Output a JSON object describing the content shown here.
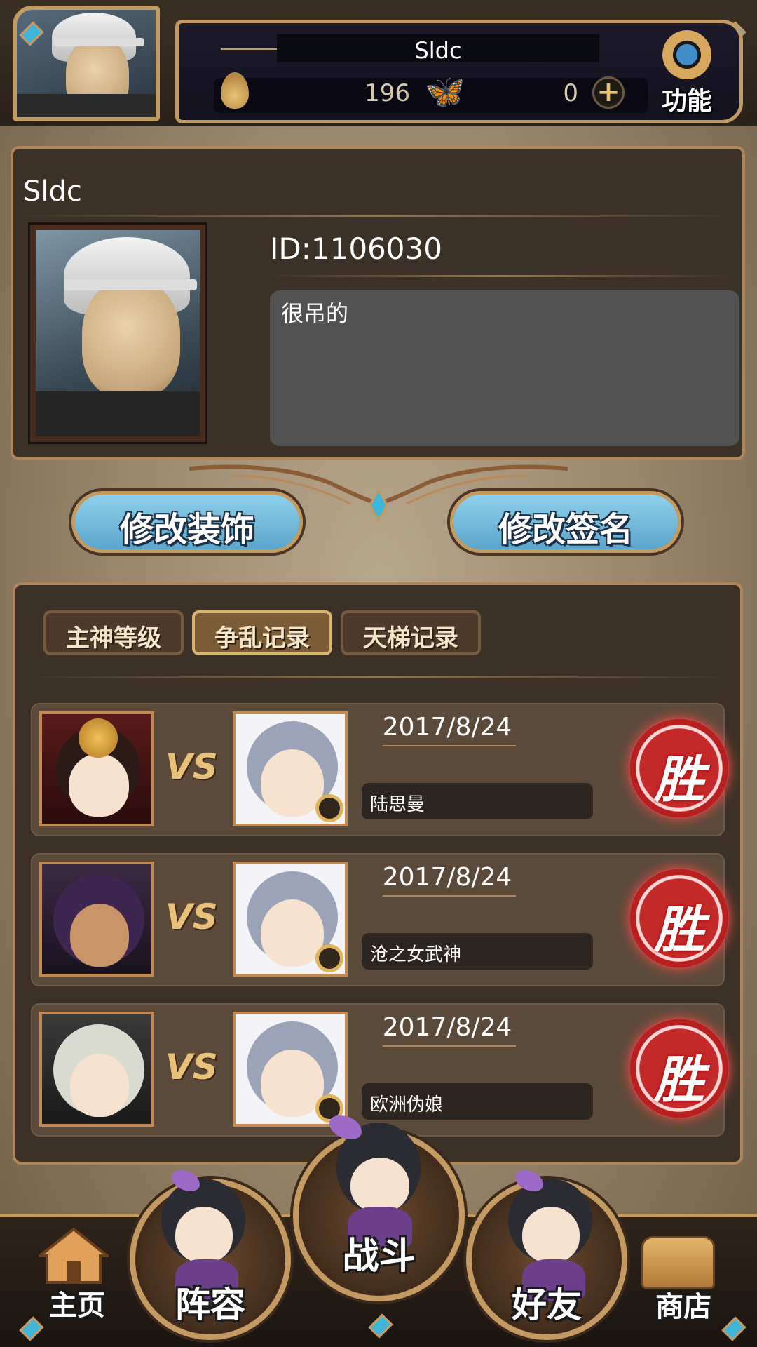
{
  "header": {
    "player_name": "Sldc",
    "flame_value": "196",
    "butterfly_value": "0",
    "function_label": "功能"
  },
  "profile": {
    "name": "Sldc",
    "id_text": "ID:1106030",
    "signature": "很吊的"
  },
  "actions": {
    "edit_decor": "修改装饰",
    "edit_signature": "修改签名"
  },
  "tabs": [
    {
      "label": "主神等级",
      "active": false
    },
    {
      "label": "争乱记录",
      "active": true
    },
    {
      "label": "天梯记录",
      "active": false
    }
  ],
  "records": [
    {
      "vs": "VS",
      "date": "2017/8/24",
      "opponent": "陆思曼",
      "result": "胜"
    },
    {
      "vs": "VS",
      "date": "2017/8/24",
      "opponent": "沧之女武神",
      "result": "胜"
    },
    {
      "vs": "VS",
      "date": "2017/8/24",
      "opponent": "欧洲伪娘",
      "result": "胜"
    }
  ],
  "nav": {
    "home": "主页",
    "lineup": "阵容",
    "battle": "战斗",
    "friends": "好友",
    "shop": "商店"
  }
}
